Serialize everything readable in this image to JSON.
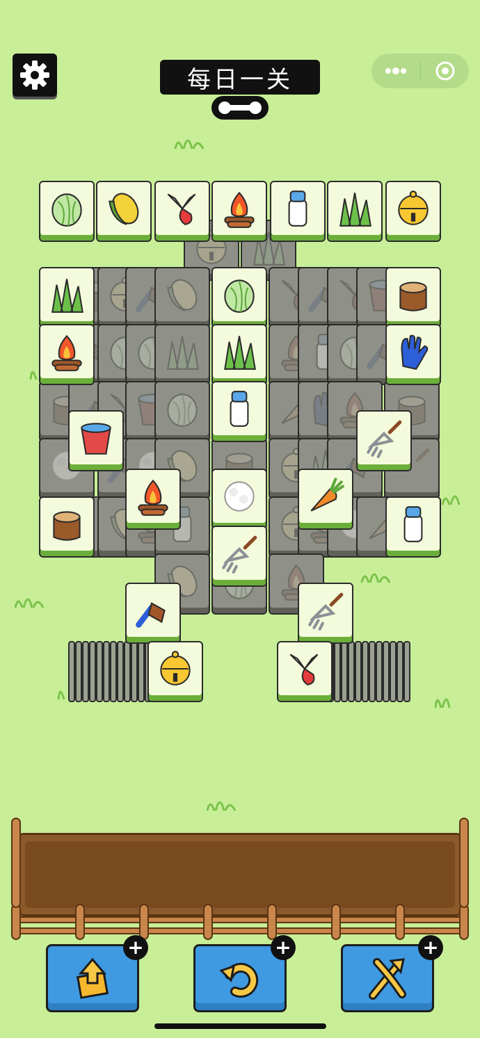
{
  "header": {
    "title": "每日一关",
    "settings_icon": "gear-icon",
    "progress_icon": "bone-icon",
    "menu_icon": "more-dots-icon",
    "close_icon": "target-circle-icon"
  },
  "colors": {
    "background": "#c8ef98",
    "tile_face": "#f4fbdc",
    "tile_base": "#6cae3a",
    "tile_covered": "#8f9188",
    "tray_wood": "#8c5a2b",
    "button_blue": "#3f9ae2"
  },
  "board": {
    "top_row": [
      "cabbage",
      "corn",
      "pruning-shears",
      "campfire",
      "milk-bottle",
      "grass",
      "bell"
    ],
    "visible_tiles": [
      "cabbage",
      "corn",
      "pruning-shears",
      "campfire",
      "milk-bottle",
      "grass",
      "bell",
      "grass",
      "cabbage",
      "tree-stump",
      "campfire",
      "grass",
      "blue-glove",
      "milk-bottle",
      "bucket",
      "pitchfork",
      "campfire",
      "cotton",
      "carrot",
      "tree-stump",
      "pitchfork",
      "milk-bottle",
      "brush",
      "pitchfork",
      "bell",
      "pruning-shears"
    ],
    "left_stack_icon": "bell",
    "right_stack_icon": "pruning-shears"
  },
  "tray": {
    "slots": 7,
    "items": []
  },
  "powerups": [
    {
      "name": "move-out",
      "icon": "move-out-icon",
      "badge": "+"
    },
    {
      "name": "undo",
      "icon": "undo-icon",
      "badge": "+"
    },
    {
      "name": "shuffle",
      "icon": "shuffle-icon",
      "badge": "+"
    }
  ]
}
